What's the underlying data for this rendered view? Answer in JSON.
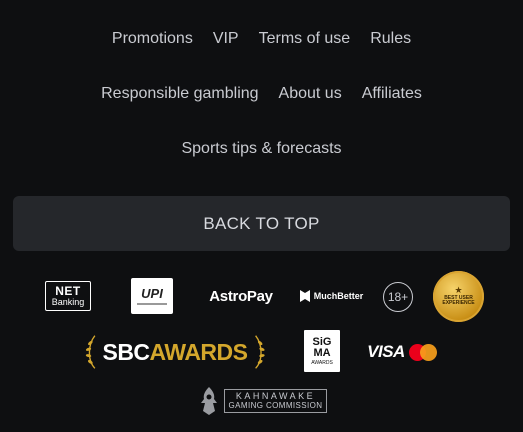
{
  "footer": {
    "links_row1": [
      "Promotions",
      "VIP",
      "Terms of use",
      "Rules"
    ],
    "links_row2": [
      "Responsible gambling",
      "About us",
      "Affiliates"
    ],
    "links_row3": [
      "Sports tips & forecasts"
    ],
    "back_to_top": "BACK TO TOP"
  },
  "partners": {
    "net_banking": {
      "line1": "NET",
      "line2": "Banking"
    },
    "upi": "UPI",
    "astropay": "AstroPay",
    "muchbetter": "MuchBetter",
    "age_limit": "18+",
    "badge": {
      "line1": "BEST USER",
      "line2": "EXPERIENCE"
    },
    "sbc": {
      "part1": "SBC",
      "part2": "AWARDS"
    },
    "sigma": {
      "line1": "SiG",
      "line2": "MA",
      "line3": "AWARDS"
    },
    "visa": "VISA",
    "kahnawake": {
      "line1": "KAHNAWAKE",
      "line2": "GAMING COMMISSION"
    }
  },
  "colors": {
    "background": "#0e0f11",
    "button_bg": "#25272b",
    "gold": "#d4a72c",
    "text": "#c9cbd1"
  }
}
